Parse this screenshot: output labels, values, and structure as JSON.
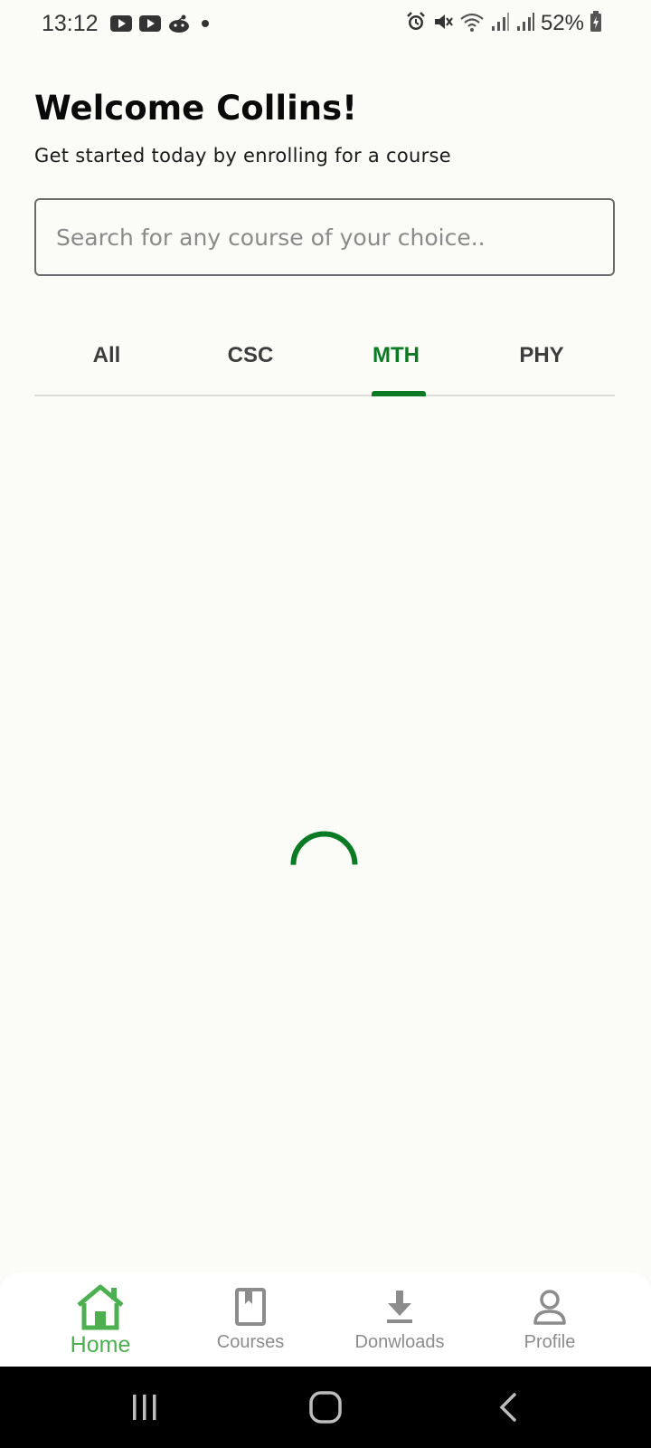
{
  "status_bar": {
    "time": "13:12",
    "battery_percent": "52%",
    "left_icons": [
      "youtube-icon",
      "youtube-icon",
      "reddit-icon",
      "dot-icon"
    ],
    "right_icons": [
      "alarm-icon",
      "mute-icon",
      "wifi-icon",
      "signal-icon",
      "signal-icon",
      "battery-charging-icon"
    ]
  },
  "header": {
    "title": "Welcome Collins!",
    "subtitle": "Get started today by enrolling for a course"
  },
  "search": {
    "placeholder": "Search for any course of your choice..",
    "value": ""
  },
  "tabs": [
    {
      "label": "All",
      "active": false
    },
    {
      "label": "CSC",
      "active": false
    },
    {
      "label": "MTH",
      "active": true
    },
    {
      "label": "PHY",
      "active": false
    }
  ],
  "loading": true,
  "bottom_nav": [
    {
      "label": "Home",
      "icon": "home-icon",
      "active": true
    },
    {
      "label": "Courses",
      "icon": "book-icon",
      "active": false
    },
    {
      "label": "Donwloads",
      "icon": "download-icon",
      "active": false
    },
    {
      "label": "Profile",
      "icon": "person-icon",
      "active": false
    }
  ],
  "colors": {
    "accent": "#0b7a25",
    "nav_active": "#4caf50",
    "background": "#fbfcf8"
  }
}
